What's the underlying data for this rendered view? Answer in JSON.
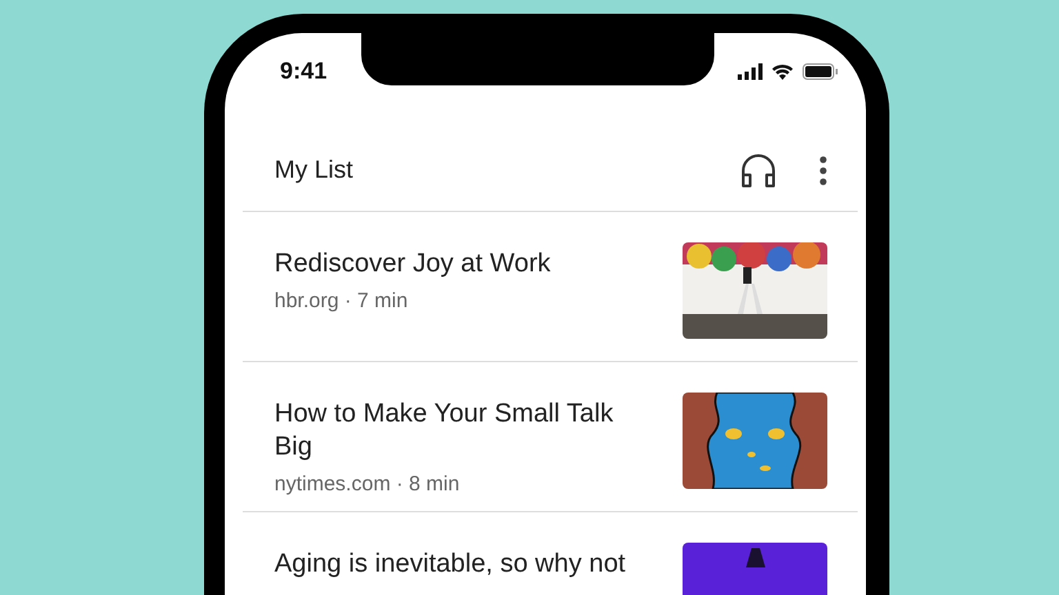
{
  "status_bar": {
    "time": "9:41"
  },
  "header": {
    "title": "My List"
  },
  "articles": [
    {
      "title": "Rediscover Joy at Work",
      "meta": "hbr.org · 7 min"
    },
    {
      "title": "How to Make Your Small Talk Big",
      "meta": "nytimes.com · 8 min"
    },
    {
      "title": "Aging is inevitable, so why not"
    }
  ]
}
